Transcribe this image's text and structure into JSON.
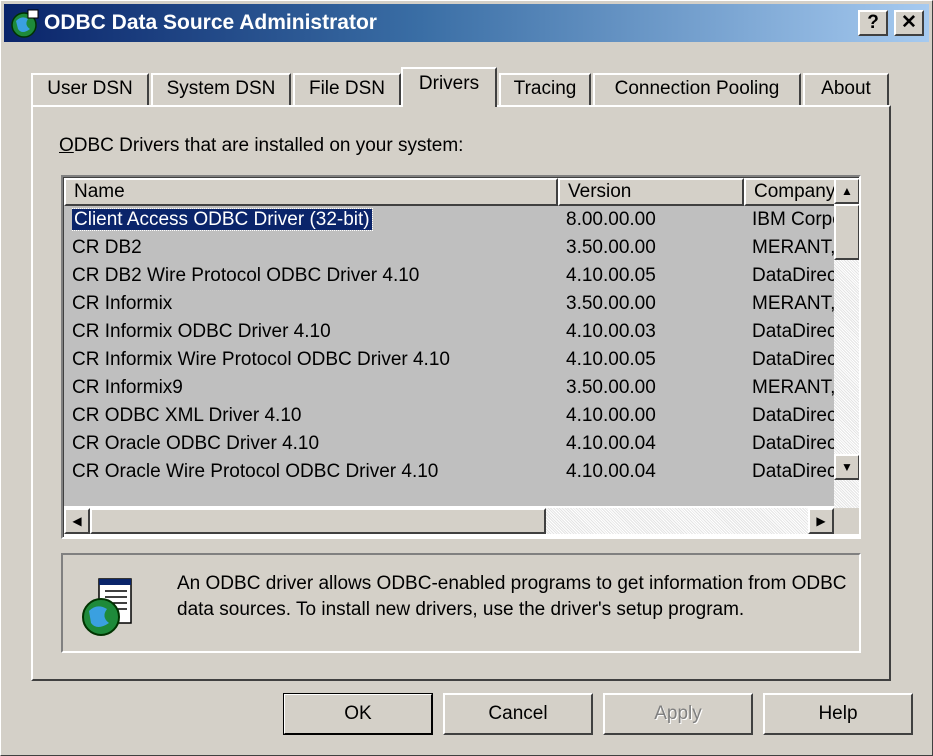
{
  "window": {
    "title": "ODBC Data Source Administrator",
    "help_glyph": "?",
    "close_glyph": "✕"
  },
  "tabs": [
    {
      "label": "User DSN",
      "active": false
    },
    {
      "label": "System DSN",
      "active": false
    },
    {
      "label": "File DSN",
      "active": false
    },
    {
      "label": "Drivers",
      "active": true
    },
    {
      "label": "Tracing",
      "active": false
    },
    {
      "label": "Connection Pooling",
      "active": false
    },
    {
      "label": "About",
      "active": false
    }
  ],
  "panel": {
    "label_accel": "O",
    "label_rest": "DBC Drivers that are installed on your system:"
  },
  "list": {
    "columns": [
      "Name",
      "Version",
      "Company"
    ],
    "rows": [
      {
        "name": "Client Access ODBC Driver (32-bit)",
        "version": "8.00.00.00",
        "company": "IBM Corpo",
        "selected": true
      },
      {
        "name": "CR DB2",
        "version": "3.50.00.00",
        "company": "MERANT,"
      },
      {
        "name": "CR DB2 Wire Protocol ODBC Driver 4.10",
        "version": "4.10.00.05",
        "company": "DataDirec"
      },
      {
        "name": "CR Informix",
        "version": "3.50.00.00",
        "company": "MERANT,"
      },
      {
        "name": "CR Informix ODBC Driver 4.10",
        "version": "4.10.00.03",
        "company": "DataDirec"
      },
      {
        "name": "CR Informix Wire Protocol ODBC Driver 4.10",
        "version": "4.10.00.05",
        "company": "DataDirec"
      },
      {
        "name": "CR Informix9",
        "version": "3.50.00.00",
        "company": "MERANT,"
      },
      {
        "name": "CR ODBC XML Driver 4.10",
        "version": "4.10.00.00",
        "company": "DataDirec"
      },
      {
        "name": "CR Oracle ODBC Driver 4.10",
        "version": "4.10.00.04",
        "company": "DataDirec"
      },
      {
        "name": "CR Oracle Wire Protocol ODBC Driver 4.10",
        "version": "4.10.00.04",
        "company": "DataDirec"
      }
    ]
  },
  "scrollbars": {
    "up": "▲",
    "down": "▼",
    "left": "◀",
    "right": "▶"
  },
  "info": {
    "text": "An ODBC driver allows ODBC-enabled programs to get information from ODBC data sources.  To install new drivers, use the driver's setup program."
  },
  "buttons": {
    "ok": "OK",
    "cancel": "Cancel",
    "apply": "Apply",
    "help": "Help"
  },
  "colors": {
    "face": "#d4d0c8",
    "title_start": "#0a246a",
    "title_end": "#a6caf0",
    "selection": "#0a246a"
  }
}
